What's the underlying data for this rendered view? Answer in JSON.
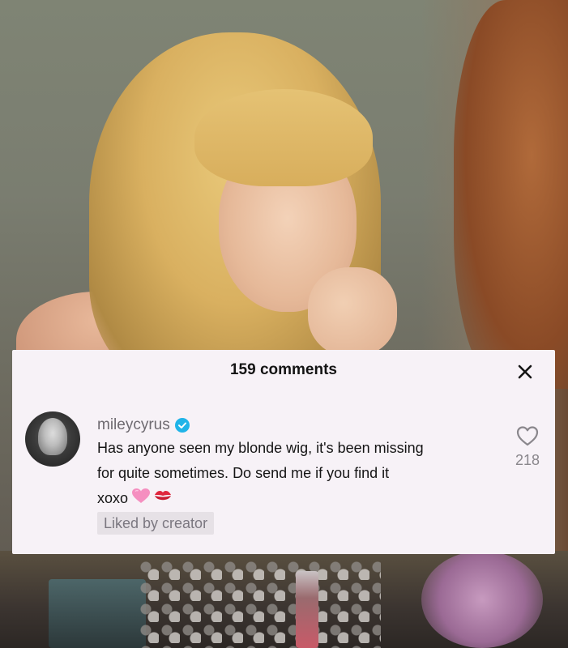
{
  "sheet": {
    "comments_count_label": "159 comments",
    "close_icon": "close-icon"
  },
  "comment": {
    "username": "mileycyrus",
    "verified_icon": "verified-badge-icon",
    "text_lines": [
      "Has anyone seen my blonde wig, it's been missing",
      "for quite sometimes. Do send me if you find it",
      "xoxo"
    ],
    "emojis": [
      "pink-heart-emoji",
      "kiss-mark-emoji"
    ],
    "liked_badge": "Liked by creator",
    "like_count": "218",
    "like_icon": "heart-outline-icon"
  },
  "colors": {
    "sheet_background": "#f7f2f7",
    "verified_blue": "#20b4e8",
    "primary_text": "#151515",
    "secondary_text": "#6e6a70"
  }
}
